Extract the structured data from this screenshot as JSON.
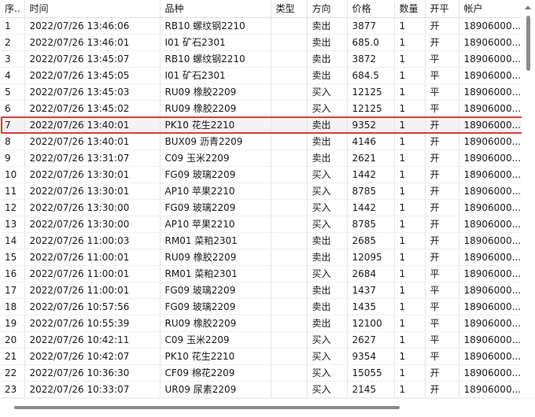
{
  "columns": [
    "序..",
    "时间",
    "品种",
    "类型",
    "方向",
    "价格",
    "数量",
    "开平",
    "帐户"
  ],
  "rows": [
    [
      "1",
      "2022/07/26 13:46:06",
      "RB10 螺纹钢2210",
      "",
      "卖出",
      "3877",
      "1",
      "开",
      "18906000..."
    ],
    [
      "2",
      "2022/07/26 13:46:01",
      "I01 矿石2301",
      "",
      "卖出",
      "685.0",
      "1",
      "开",
      "18906000..."
    ],
    [
      "3",
      "2022/07/26 13:45:07",
      "RB10 螺纹钢2210",
      "",
      "卖出",
      "3872",
      "1",
      "平",
      "18906000..."
    ],
    [
      "4",
      "2022/07/26 13:45:05",
      "I01 矿石2301",
      "",
      "卖出",
      "684.5",
      "1",
      "平",
      "18906000..."
    ],
    [
      "5",
      "2022/07/26 13:45:03",
      "RU09 橡胶2209",
      "",
      "买入",
      "12125",
      "1",
      "平",
      "18906000..."
    ],
    [
      "6",
      "2022/07/26 13:45:02",
      "RU09 橡胶2209",
      "",
      "买入",
      "12125",
      "1",
      "平",
      "18906000..."
    ],
    [
      "7",
      "2022/07/26 13:40:01",
      "PK10 花生2210",
      "",
      "卖出",
      "9352",
      "1",
      "开",
      "18906000..."
    ],
    [
      "8",
      "2022/07/26 13:40:01",
      "BUX09 沥青2209",
      "",
      "卖出",
      "4146",
      "1",
      "开",
      "18906000..."
    ],
    [
      "9",
      "2022/07/26 13:31:07",
      "C09 玉米2209",
      "",
      "卖出",
      "2621",
      "1",
      "开",
      "18906000..."
    ],
    [
      "10",
      "2022/07/26 13:30:01",
      "FG09 玻璃2209",
      "",
      "买入",
      "1442",
      "1",
      "开",
      "18906000..."
    ],
    [
      "11",
      "2022/07/26 13:30:01",
      "AP10 苹果2210",
      "",
      "买入",
      "8785",
      "1",
      "开",
      "18906000..."
    ],
    [
      "12",
      "2022/07/26 13:30:00",
      "FG09 玻璃2209",
      "",
      "买入",
      "1442",
      "1",
      "开",
      "18906000..."
    ],
    [
      "13",
      "2022/07/26 13:30:00",
      "AP10 苹果2210",
      "",
      "买入",
      "8785",
      "1",
      "开",
      "18906000..."
    ],
    [
      "14",
      "2022/07/26 11:00:03",
      "RM01 菜粕2301",
      "",
      "卖出",
      "2685",
      "1",
      "开",
      "18906000..."
    ],
    [
      "15",
      "2022/07/26 11:00:01",
      "RU09 橡胶2209",
      "",
      "卖出",
      "12095",
      "1",
      "开",
      "18906000..."
    ],
    [
      "16",
      "2022/07/26 11:00:01",
      "RM01 菜粕2301",
      "",
      "买入",
      "2684",
      "1",
      "平",
      "18906000..."
    ],
    [
      "17",
      "2022/07/26 11:00:01",
      "FG09 玻璃2209",
      "",
      "卖出",
      "1437",
      "1",
      "平",
      "18906000..."
    ],
    [
      "18",
      "2022/07/26 10:57:56",
      "FG09 玻璃2209",
      "",
      "卖出",
      "1435",
      "1",
      "平",
      "18906000..."
    ],
    [
      "19",
      "2022/07/26 10:55:39",
      "RU09 橡胶2209",
      "",
      "卖出",
      "12100",
      "1",
      "平",
      "18906000..."
    ],
    [
      "20",
      "2022/07/26 10:42:11",
      "C09 玉米2209",
      "",
      "买入",
      "2627",
      "1",
      "平",
      "18906000..."
    ],
    [
      "21",
      "2022/07/26 10:42:07",
      "PK10 花生2210",
      "",
      "买入",
      "9354",
      "1",
      "平",
      "18906000..."
    ],
    [
      "22",
      "2022/07/26 10:36:30",
      "CF09 棉花2209",
      "",
      "买入",
      "15055",
      "1",
      "开",
      "18906000..."
    ],
    [
      "23",
      "2022/07/26 10:33:07",
      "UR09 尿素2209",
      "",
      "买入",
      "2145",
      "1",
      "开",
      "18906000..."
    ]
  ],
  "selected_row_index": 6,
  "colors": {
    "highlight": "#e23a3a",
    "selected_bg": "#f3f3f3"
  }
}
